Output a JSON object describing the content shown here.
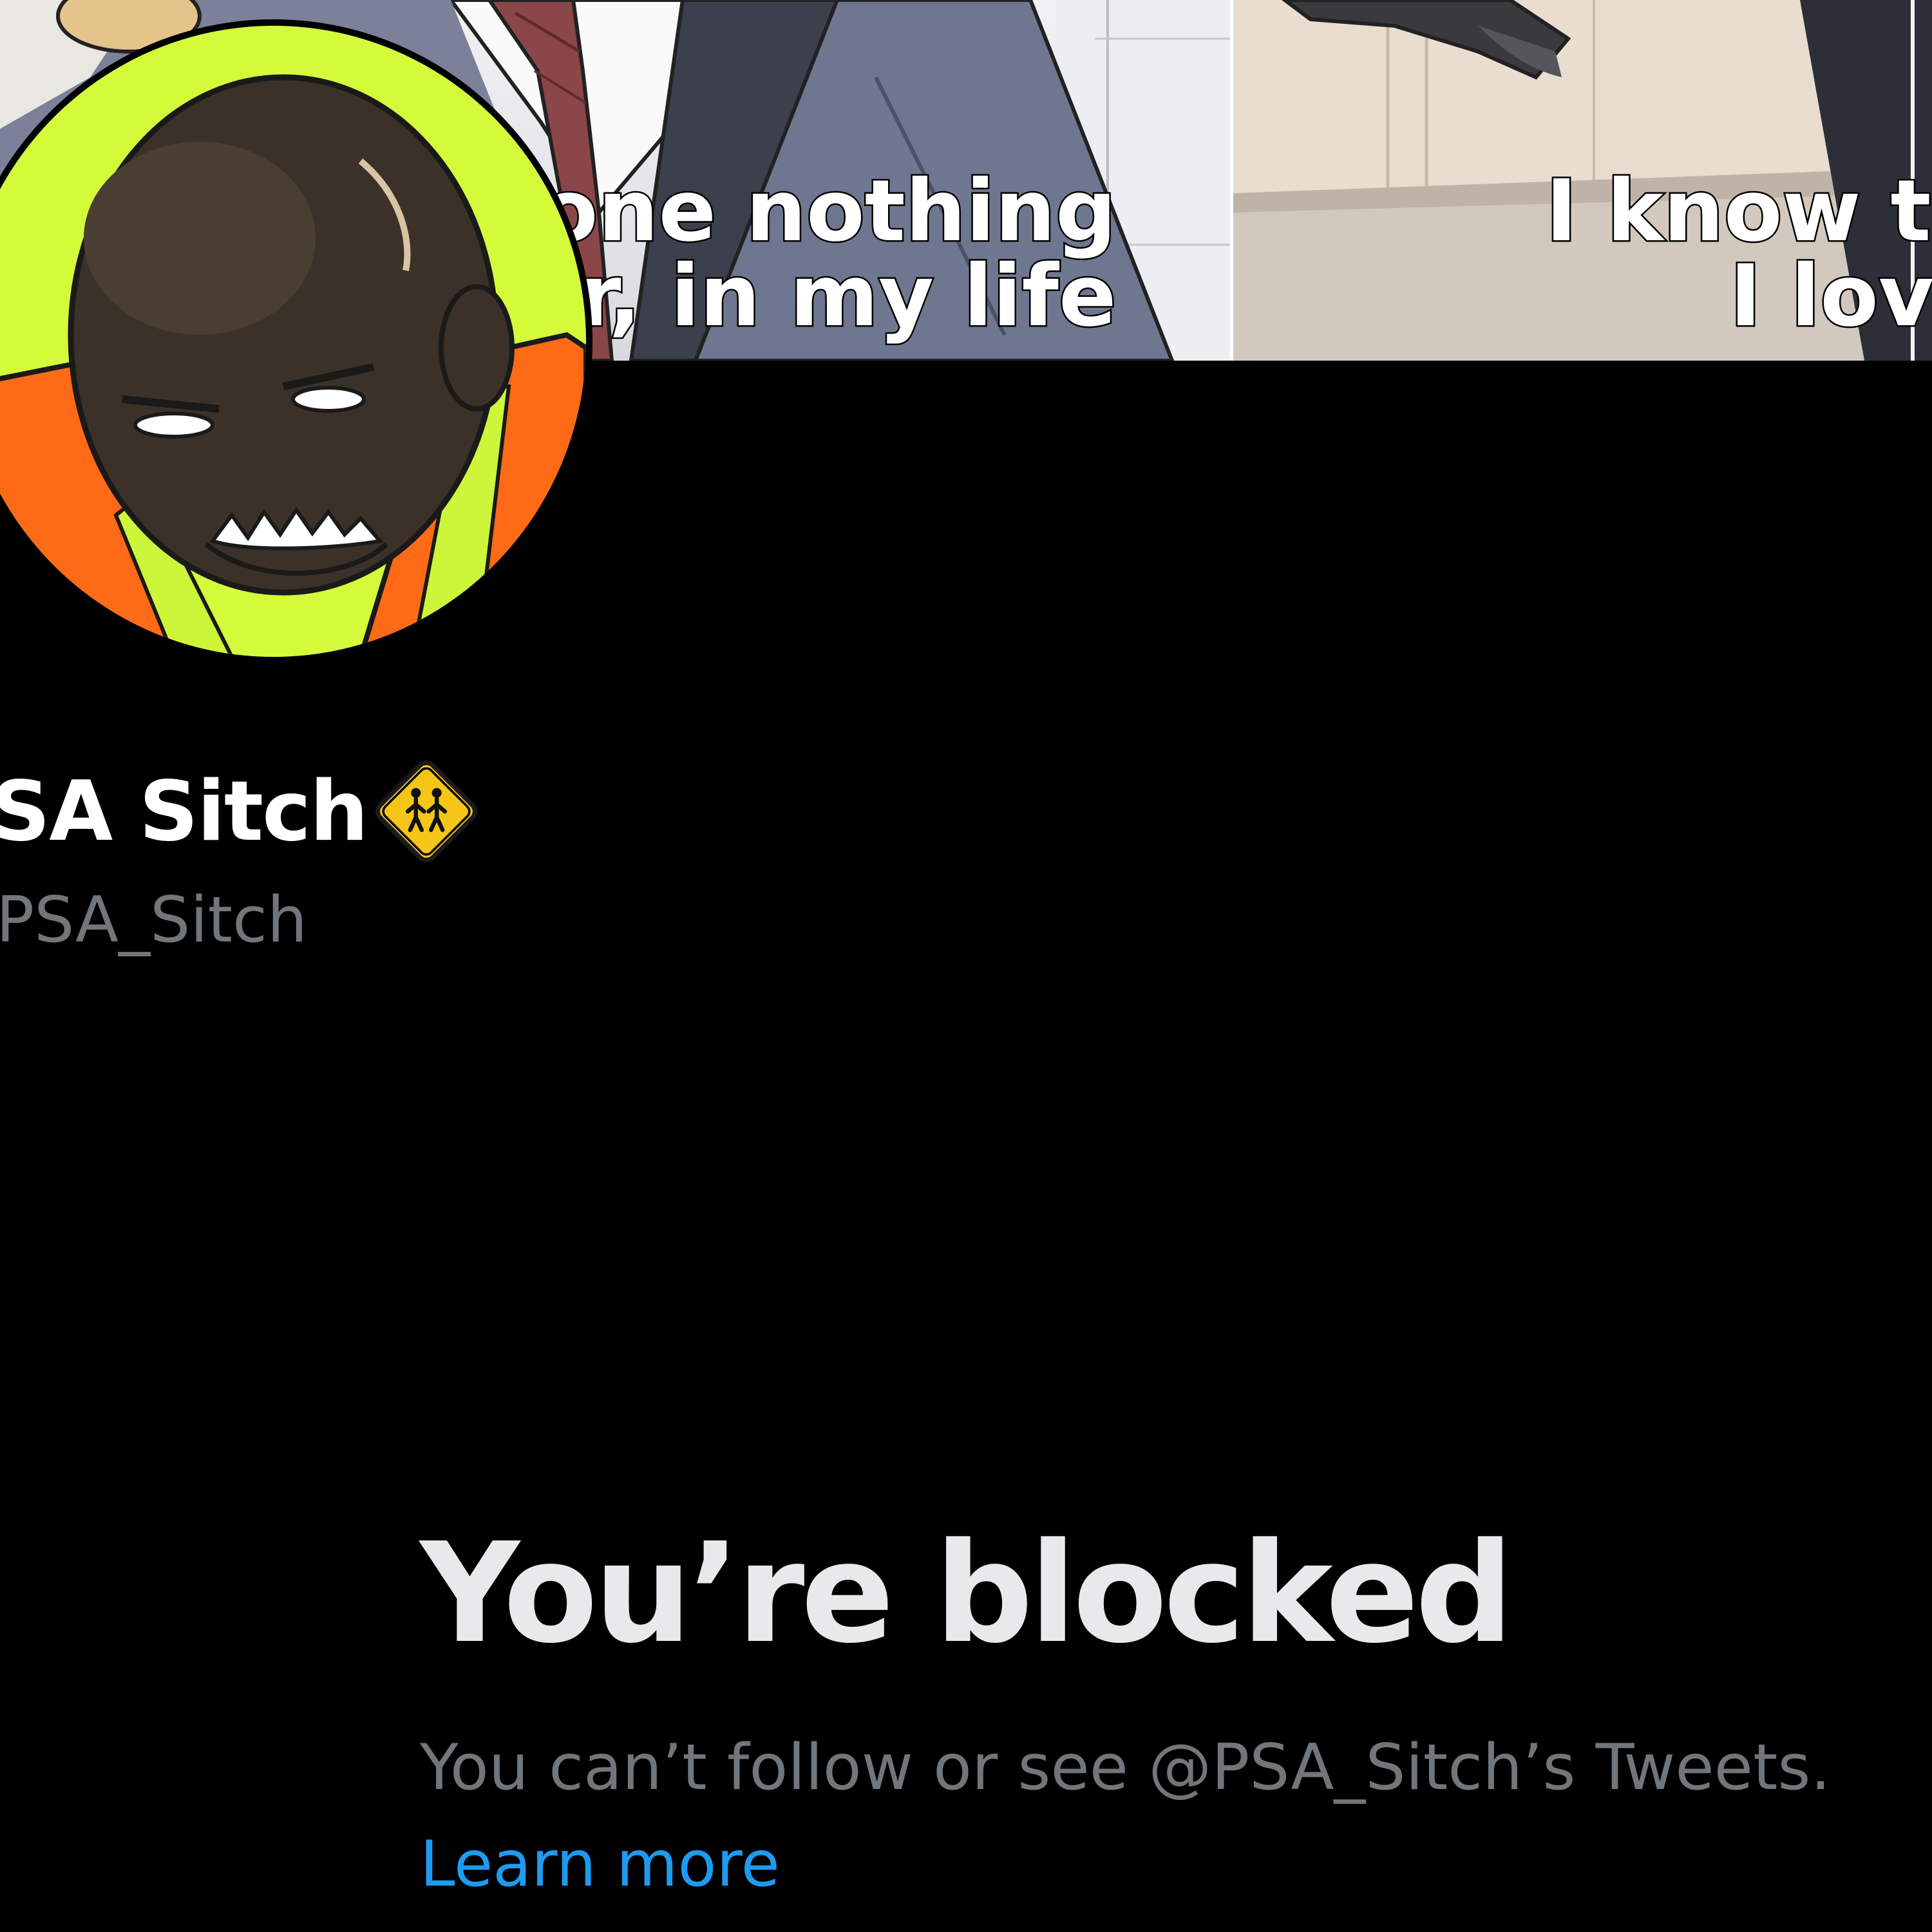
{
  "profile": {
    "display_name": "SA Sitch",
    "handle": "PSA_Sitch",
    "badge_icon": "school-crossing-badge-icon"
  },
  "header": {
    "caption_left_line1": "one nothing",
    "caption_left_line2": "er, in my life",
    "caption_right_line1": "I know th",
    "caption_right_line2": "I love"
  },
  "blocked": {
    "title": "You’re blocked",
    "message": "You can’t follow or see @PSA_Sitch’s Tweets.",
    "link_text": "Learn more"
  },
  "colors": {
    "background": "#000000",
    "primary_text": "#e7e9ea",
    "secondary_text": "#71767b",
    "link": "#1d9bf0",
    "avatar_bg": "#d3fb3a",
    "badge_yellow": "#f5c518"
  }
}
